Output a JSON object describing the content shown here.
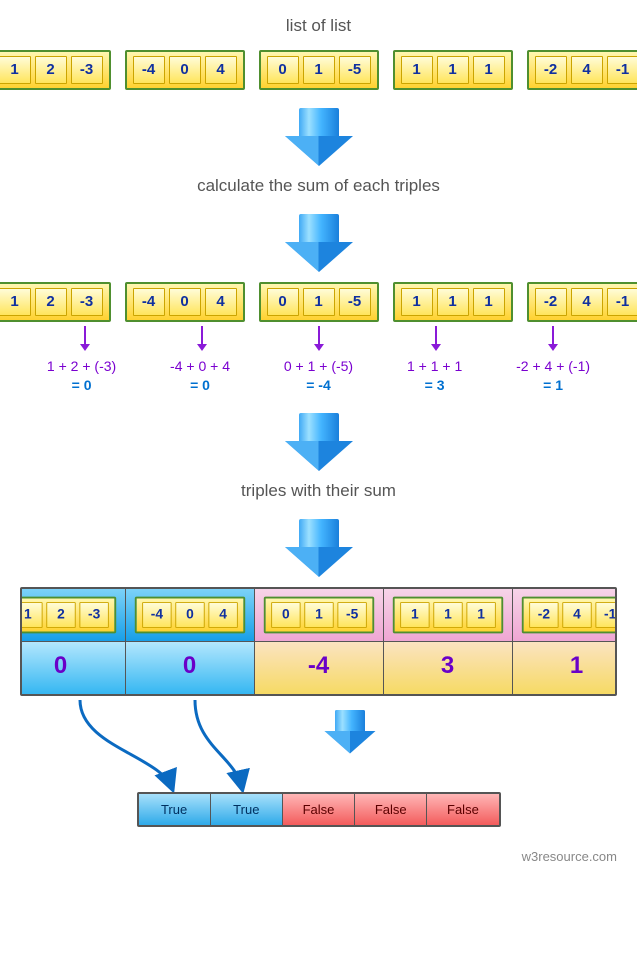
{
  "labels": {
    "list_of_list": "list of list",
    "calc_sum": "calculate the sum of each triples",
    "with_sum": "triples with their sum"
  },
  "triples": [
    [
      "1",
      "2",
      "-3"
    ],
    [
      "-4",
      "0",
      "4"
    ],
    [
      "0",
      "1",
      "-5"
    ],
    [
      "1",
      "1",
      "1"
    ],
    [
      "-2",
      "4",
      "-1"
    ]
  ],
  "expressions": [
    {
      "expr": "1 + 2 + (-3)",
      "result": "= 0"
    },
    {
      "expr": "-4 + 0 + 4",
      "result": "= 0"
    },
    {
      "expr": "0 + 1 + (-5)",
      "result": "= -4"
    },
    {
      "expr": "1 + 1 + 1",
      "result": "= 3"
    },
    {
      "expr": "-2 + 4 + (-1)",
      "result": "= 1"
    }
  ],
  "sums": [
    "0",
    "0",
    "-4",
    "3",
    "1"
  ],
  "sum_is_zero": [
    true,
    true,
    false,
    false,
    false
  ],
  "results": [
    "True",
    "True",
    "False",
    "False",
    "False"
  ],
  "footer": "w3resource.com",
  "chart_data": {
    "type": "table",
    "description": "For each triple compute its sum; sum == 0 → True else False",
    "rows": [
      {
        "triple": [
          1,
          2,
          -3
        ],
        "sum": 0,
        "is_zero": true
      },
      {
        "triple": [
          -4,
          0,
          4
        ],
        "sum": 0,
        "is_zero": true
      },
      {
        "triple": [
          0,
          1,
          -5
        ],
        "sum": -4,
        "is_zero": false
      },
      {
        "triple": [
          1,
          1,
          1
        ],
        "sum": 3,
        "is_zero": false
      },
      {
        "triple": [
          -2,
          4,
          -1
        ],
        "sum": 1,
        "is_zero": false
      }
    ]
  }
}
